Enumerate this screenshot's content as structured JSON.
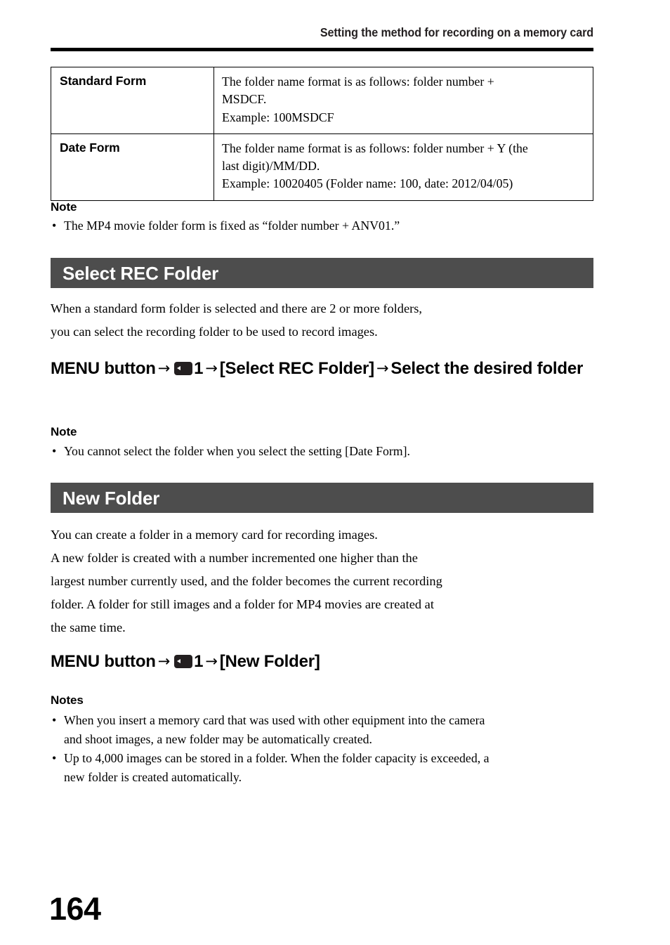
{
  "header": {
    "running_title": "Setting the method for recording on a memory card"
  },
  "table": {
    "rows": [
      {
        "label": "Standard Form",
        "lines": [
          "The folder name format is as follows: folder number +",
          "MSDCF.",
          "Example: 100MSDCF"
        ]
      },
      {
        "label": "Date Form",
        "lines": [
          "The folder name format is as follows: folder number + Y (the",
          "last digit)/MM/DD.",
          "Example: 10020405 (Folder name: 100, date: 2012/04/05)"
        ]
      }
    ]
  },
  "note_top": {
    "heading": "Note",
    "bullet_char": "•",
    "items": [
      [
        "The MP4 movie folder form is fixed as “folder number + ANV01.”"
      ]
    ]
  },
  "section_select_rec": {
    "title": "Select REC Folder",
    "body_lines": [
      "When a standard form folder is selected and there are 2 or more folders,",
      "you can select the recording folder to be used to record images."
    ],
    "menu_path": {
      "prefix": "MENU button",
      "arrow": "→",
      "icon_name": "setup-menu-icon",
      "tab_number": "1",
      "item": "[Select REC Folder]",
      "suffix": "Select the desired folder"
    },
    "note": {
      "heading": "Note",
      "bullet_char": "•",
      "items": [
        [
          "You cannot select the folder when you select the setting [Date Form]."
        ]
      ]
    }
  },
  "section_new_folder": {
    "title": "New Folder",
    "body_lines": [
      "You can create a folder in a memory card for recording images.",
      "A new folder is created with a number incremented one higher than the",
      "largest number currently used, and the folder becomes the current recording",
      "folder. A folder for still images and a folder for MP4 movies are created at",
      "the same time."
    ],
    "menu_path": {
      "prefix": "MENU button",
      "arrow": "→",
      "icon_name": "setup-menu-icon",
      "tab_number": "1",
      "item": "[New Folder]"
    },
    "notes": {
      "heading": "Notes",
      "bullet_char": "•",
      "items": [
        [
          "When you insert a memory card that was used with other equipment into the camera",
          "and shoot images, a new folder may be automatically created."
        ],
        [
          "Up to 4,000 images can be stored in a folder. When the folder capacity is exceeded, a",
          "new folder is created automatically."
        ]
      ]
    }
  },
  "footer": {
    "page_number": "164"
  },
  "colors": {
    "section_bar": "#4d4d4d",
    "rule": "#000000",
    "text": "#000000",
    "section_bar_text": "#ffffff"
  }
}
